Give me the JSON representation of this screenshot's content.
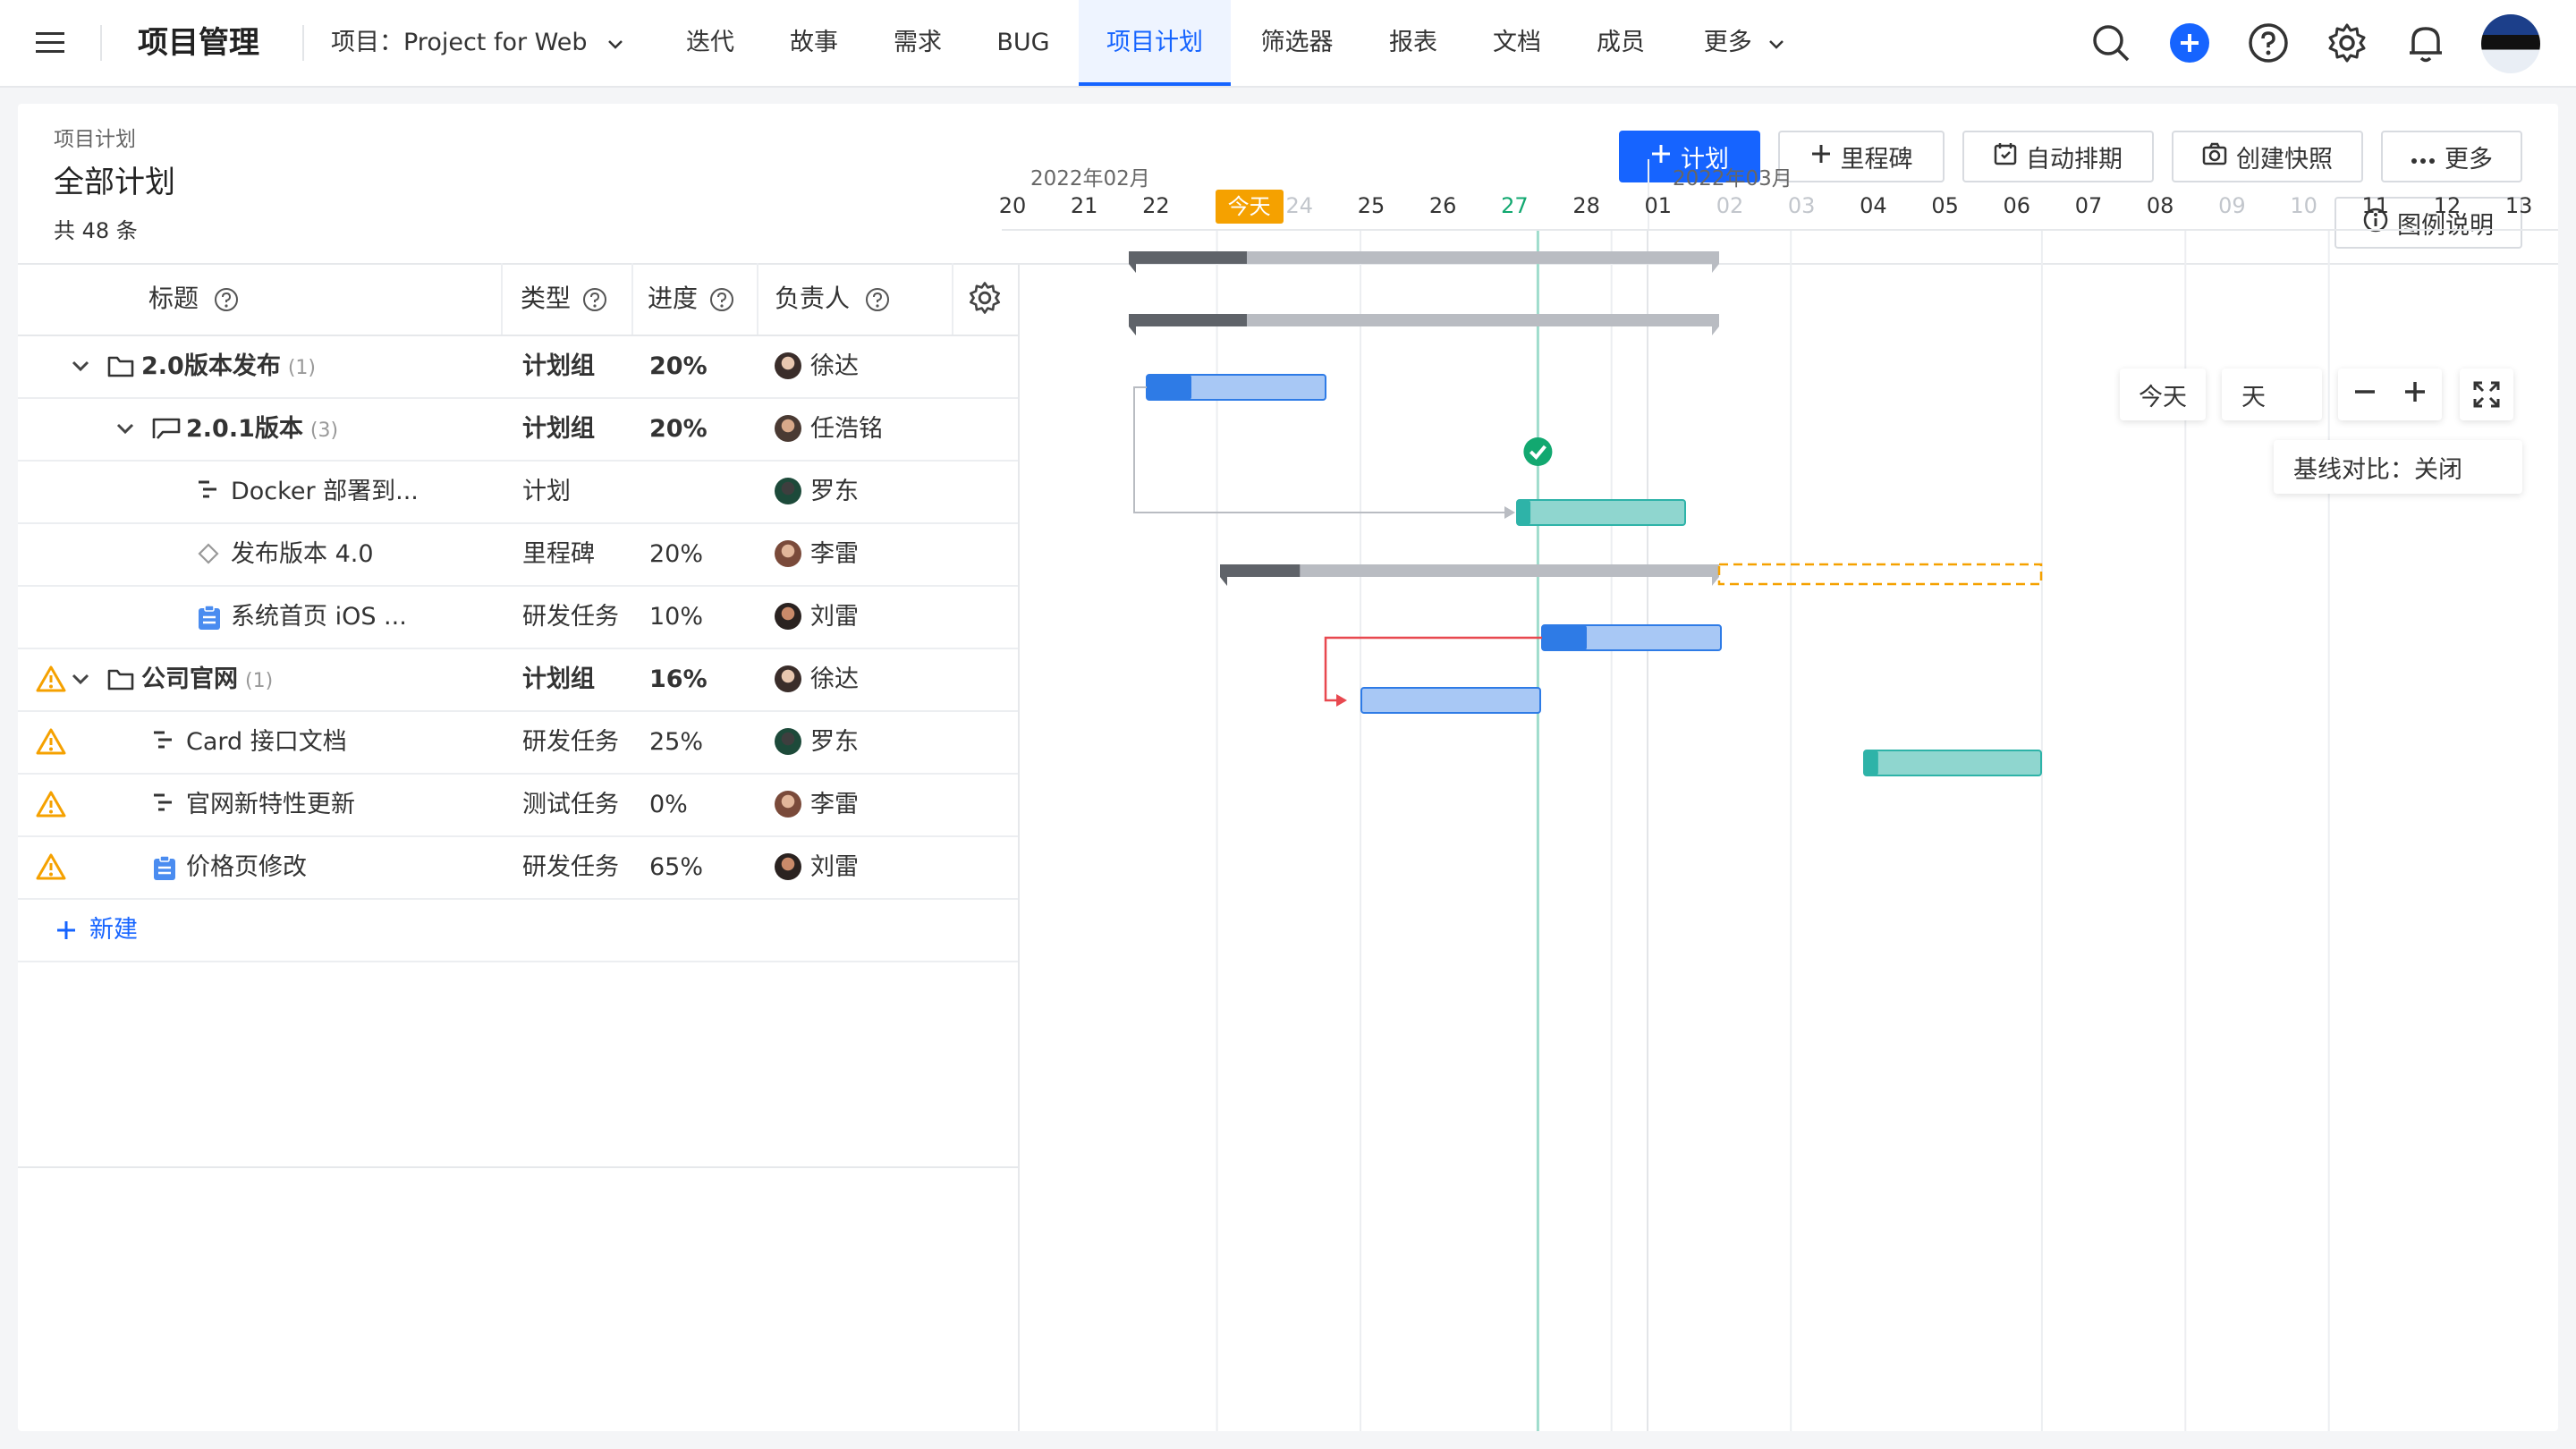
{
  "nav": {
    "app_title": "项目管理",
    "project_label": "项目：Project for Web",
    "tabs": [
      {
        "label": "迭代"
      },
      {
        "label": "故事"
      },
      {
        "label": "需求"
      },
      {
        "label": "BUG"
      },
      {
        "label": "项目计划"
      },
      {
        "label": "筛选器"
      },
      {
        "label": "报表"
      },
      {
        "label": "文档"
      },
      {
        "label": "成员"
      },
      {
        "label": "更多"
      }
    ],
    "active_tab": "项目计划",
    "icons": [
      "menu-icon",
      "search-icon",
      "add-icon",
      "help-icon",
      "gear-icon",
      "bell-icon",
      "avatar"
    ],
    "accent_color": "#1664ff"
  },
  "header": {
    "breadcrumb": "项目计划",
    "title": "全部计划",
    "count_label": "共 48 条"
  },
  "toolbar": {
    "plan_btn": "计划",
    "milestone_btn": "里程碑",
    "auto_schedule_btn": "自动排期",
    "snapshot_btn": "创建快照",
    "more_btn": "更多",
    "legend_btn": "图例说明"
  },
  "table": {
    "columns": [
      "标题",
      "类型",
      "进度",
      "负责人"
    ],
    "rows": [
      {
        "title": "2.0版本发布",
        "count": "(1)",
        "type": "计划组",
        "progress": "20%",
        "owner": "徐达",
        "bold": true,
        "warn": false,
        "icon": "folder-icon"
      },
      {
        "title": "2.0.1版本",
        "count": "(3)",
        "type": "计划组",
        "progress": "20%",
        "owner": "任浩铭",
        "bold": true,
        "warn": false,
        "icon": "flag-icon"
      },
      {
        "title": "Docker 部署到...",
        "count": "",
        "type": "计划",
        "progress": "",
        "owner": "罗东",
        "bold": false,
        "warn": false,
        "icon": "plan-icon"
      },
      {
        "title": "发布版本 4.0",
        "count": "",
        "type": "里程碑",
        "progress": "20%",
        "owner": "李雷",
        "bold": false,
        "warn": false,
        "icon": "diamond-icon"
      },
      {
        "title": "系统首页 iOS ...",
        "count": "",
        "type": "研发任务",
        "progress": "10%",
        "owner": "刘雷",
        "bold": false,
        "warn": false,
        "icon": "task-icon"
      },
      {
        "title": "公司官网",
        "count": "(1)",
        "type": "计划组",
        "progress": "16%",
        "owner": "徐达",
        "bold": true,
        "warn": true,
        "icon": "folder-icon"
      },
      {
        "title": "Card 接口文档",
        "count": "",
        "type": "研发任务",
        "progress": "25%",
        "owner": "罗东",
        "bold": false,
        "warn": true,
        "icon": "plan-icon"
      },
      {
        "title": "官网新特性更新",
        "count": "",
        "type": "测试任务",
        "progress": "0%",
        "owner": "李雷",
        "bold": false,
        "warn": true,
        "icon": "plan-icon"
      },
      {
        "title": "价格页修改",
        "count": "",
        "type": "研发任务",
        "progress": "65%",
        "owner": "刘雷",
        "bold": false,
        "warn": true,
        "icon": "task-icon"
      }
    ],
    "new_label": "新建"
  },
  "gantt": {
    "months": [
      "2022年02月",
      "2022年03月"
    ],
    "days": [
      {
        "d": "20",
        "weekend": false
      },
      {
        "d": "21",
        "weekend": false
      },
      {
        "d": "22",
        "weekend": false
      },
      {
        "d": "今天",
        "weekend": false,
        "today": true
      },
      {
        "d": "24",
        "weekend": true
      },
      {
        "d": "25",
        "weekend": false
      },
      {
        "d": "26",
        "weekend": false
      },
      {
        "d": "27",
        "weekend": false,
        "marker": true
      },
      {
        "d": "28",
        "weekend": false
      },
      {
        "d": "01",
        "weekend": false
      },
      {
        "d": "02",
        "weekend": true
      },
      {
        "d": "03",
        "weekend": true
      },
      {
        "d": "04",
        "weekend": false
      },
      {
        "d": "05",
        "weekend": false
      },
      {
        "d": "06",
        "weekend": false
      },
      {
        "d": "07",
        "weekend": false
      },
      {
        "d": "08",
        "weekend": false
      },
      {
        "d": "09",
        "weekend": true
      },
      {
        "d": "10",
        "weekend": true
      },
      {
        "d": "11",
        "weekend": false
      },
      {
        "d": "12",
        "weekend": false
      },
      {
        "d": "13",
        "weekend": false
      }
    ],
    "today_btn": "今天",
    "scale_label": "天",
    "baseline_label": "基线对比：关闭",
    "today_color": "#f5a100",
    "task_color": "#a8c8f5",
    "test_color": "#8fd6cf"
  }
}
